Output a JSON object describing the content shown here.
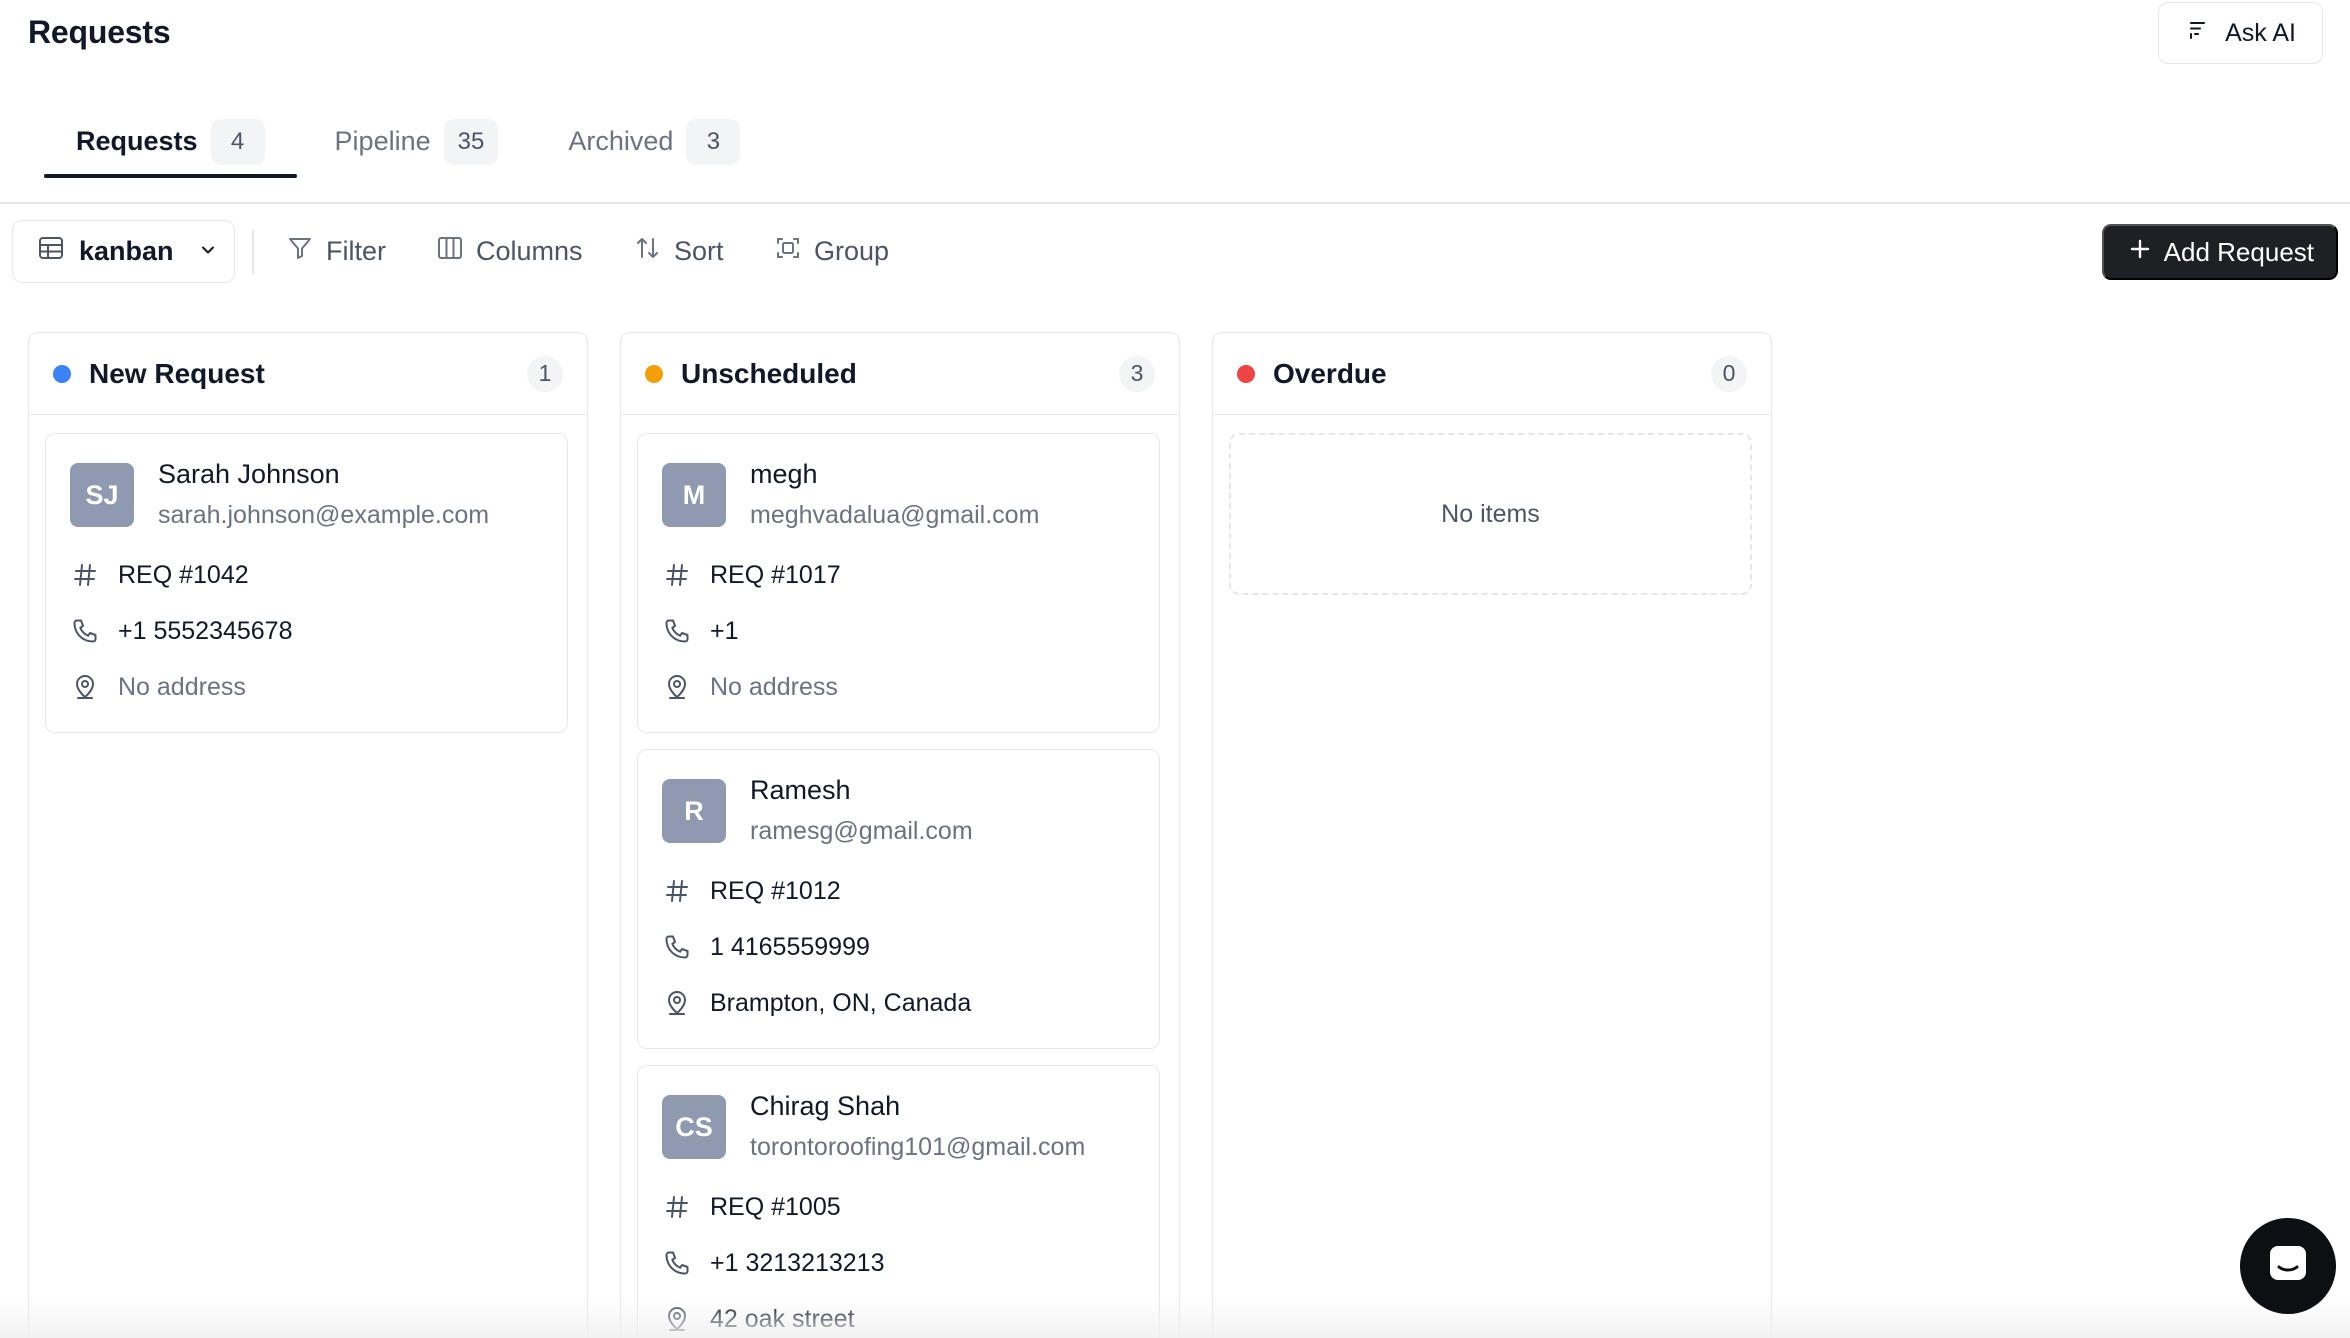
{
  "header": {
    "title": "Requests",
    "ask_ai_label": "Ask AI"
  },
  "tabs": [
    {
      "label": "Requests",
      "count": "4",
      "active": true
    },
    {
      "label": "Pipeline",
      "count": "35",
      "active": false
    },
    {
      "label": "Archived",
      "count": "3",
      "active": false
    }
  ],
  "toolbar": {
    "view_label": "kanban",
    "filter_label": "Filter",
    "columns_label": "Columns",
    "sort_label": "Sort",
    "group_label": "Group",
    "add_label": "Add Request"
  },
  "colors": {
    "new_request": "#3b82f6",
    "unscheduled": "#f59e0b",
    "overdue": "#ef4444",
    "avatar_bg": "#8f9ab0",
    "primary_button": "#1f2023"
  },
  "columns": [
    {
      "title": "New Request",
      "count": "1",
      "cards": [
        {
          "initials": "SJ",
          "name": "Sarah Johnson",
          "email": "sarah.johnson@example.com",
          "req": "REQ #1042",
          "phone": "+1 5552345678",
          "address": "No address"
        }
      ]
    },
    {
      "title": "Unscheduled",
      "count": "3",
      "cards": [
        {
          "initials": "M",
          "name": "megh",
          "email": "meghvadalua@gmail.com",
          "req": "REQ #1017",
          "phone": "+1",
          "address": "No address"
        },
        {
          "initials": "R",
          "name": "Ramesh",
          "email": "ramesg@gmail.com",
          "req": "REQ #1012",
          "phone": "1 4165559999",
          "address": "Brampton, ON, Canada"
        },
        {
          "initials": "CS",
          "name": "Chirag Shah",
          "email": "torontoroofing101@gmail.com",
          "req": "REQ #1005",
          "phone": "+1 3213213213",
          "address": "42 oak street"
        }
      ]
    },
    {
      "title": "Overdue",
      "count": "0",
      "empty_label": "No items",
      "cards": []
    }
  ],
  "icons": {
    "ask_ai": "sparkle-lines-icon",
    "view": "table-grid-icon",
    "view_chevron": "chevron-down-icon",
    "filter": "funnel-icon",
    "columns": "columns-icon",
    "sort": "sort-arrows-icon",
    "group": "group-icon",
    "add": "plus-icon",
    "req": "hash-icon",
    "phone": "phone-icon",
    "address": "map-pin-icon",
    "chat": "chat-icon"
  }
}
